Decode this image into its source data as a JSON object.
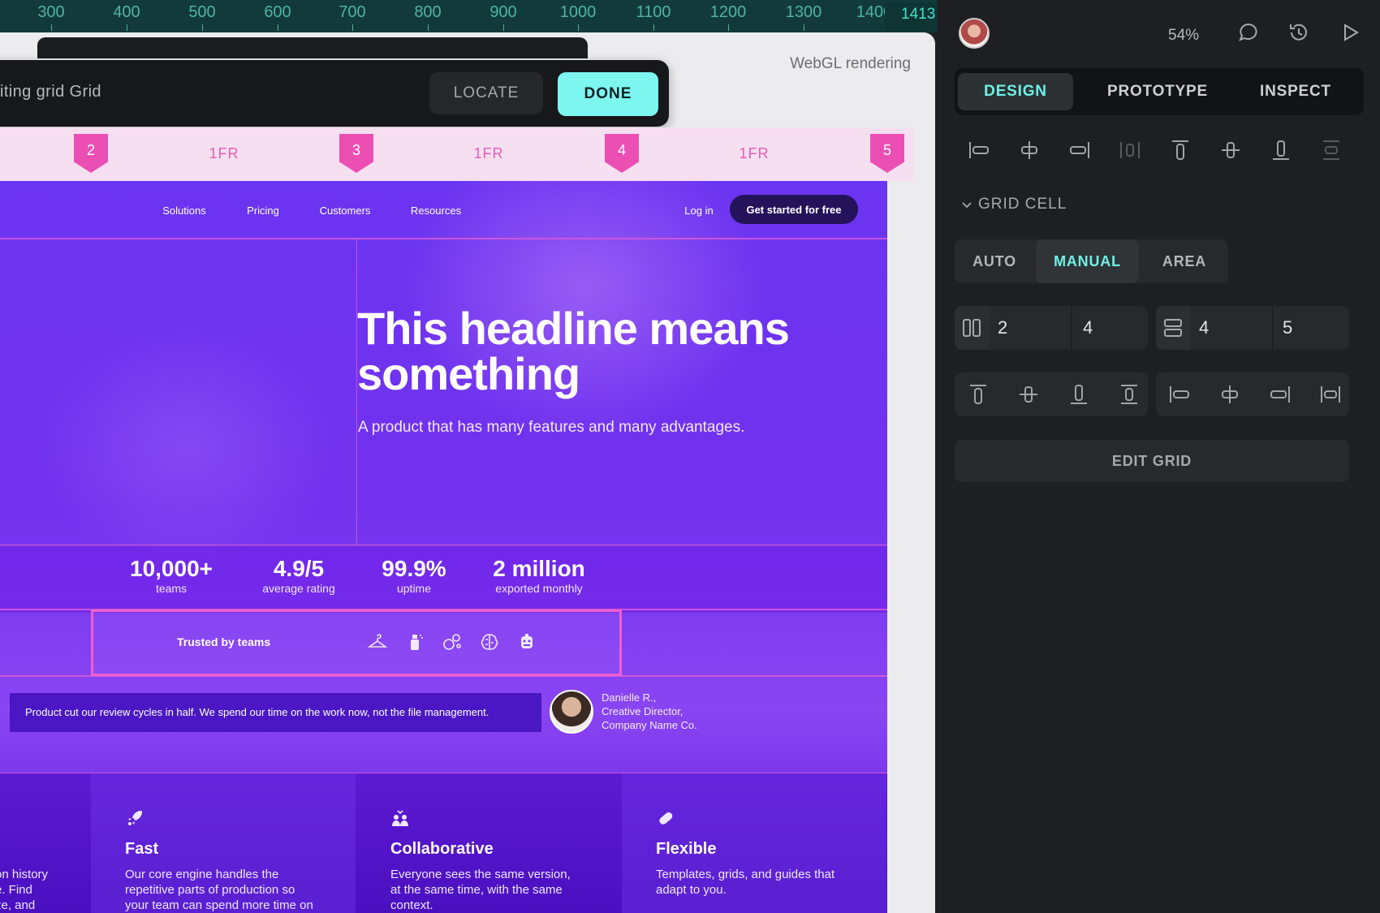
{
  "ruler": {
    "ticks": [
      "300",
      "400",
      "500",
      "600",
      "700",
      "800",
      "900",
      "1000",
      "1100",
      "1200",
      "1300",
      "1400"
    ],
    "current_value": "1413"
  },
  "canvas": {
    "render_label": "WebGL rendering",
    "edit_title": "iting grid Grid",
    "locate_label": "LOCATE",
    "done_label": "DONE",
    "markers": [
      "2",
      "3",
      "4",
      "5"
    ],
    "fr_labels": [
      "1FR",
      "1FR",
      "1FR"
    ]
  },
  "site": {
    "nav": [
      "Solutions",
      "Pricing",
      "Customers",
      "Resources"
    ],
    "login": "Log in",
    "cta": "Get started for free",
    "hero_title": "This headline means something",
    "hero_subtitle": "A product that has many features and many advantages.",
    "stats": [
      {
        "value": "10,000+",
        "label": "teams"
      },
      {
        "value": "4.9/5",
        "label": "average rating"
      },
      {
        "value": "99.9%",
        "label": "uptime"
      },
      {
        "value": "2 million",
        "label": "exported monthly"
      }
    ],
    "trusted_label": "Trusted by teams",
    "logos": [
      "hanger-icon",
      "spray-bottle-icon",
      "bubbles-icon",
      "brain-icon",
      "robot-icon"
    ],
    "quote": "Product cut our review cycles in half. We spend our time on the work now, not the file management.",
    "quote_author": "Danielle R.,",
    "quote_role": "Creative Director,",
    "quote_company": "Company Name Co.",
    "partial_desc": "on history\ne. Find\nze,  and",
    "features": [
      {
        "icon": "rocket-icon",
        "title": "Fast",
        "desc": "Our core engine handles the repetitive parts of production so your team can spend more time on the parts that matter."
      },
      {
        "icon": "people-icon",
        "title": "Collaborative",
        "desc": "Everyone sees the same version, at the same time, with the same context."
      },
      {
        "icon": "pill-icon",
        "title": "Flexible",
        "desc": "Templates, grids, and guides that adapt to you."
      }
    ]
  },
  "panel": {
    "zoom": "54%",
    "tabs": [
      "DESIGN",
      "PROTOTYPE",
      "INSPECT"
    ],
    "active_tab": "DESIGN",
    "section_title": "GRID CELL",
    "modes": [
      "AUTO",
      "MANUAL",
      "AREA"
    ],
    "active_mode": "MANUAL",
    "column_start": "2",
    "column_end": "4",
    "row_start": "4",
    "row_end": "5",
    "edit_grid": "EDIT GRID",
    "accent": "#6ff1e6"
  }
}
